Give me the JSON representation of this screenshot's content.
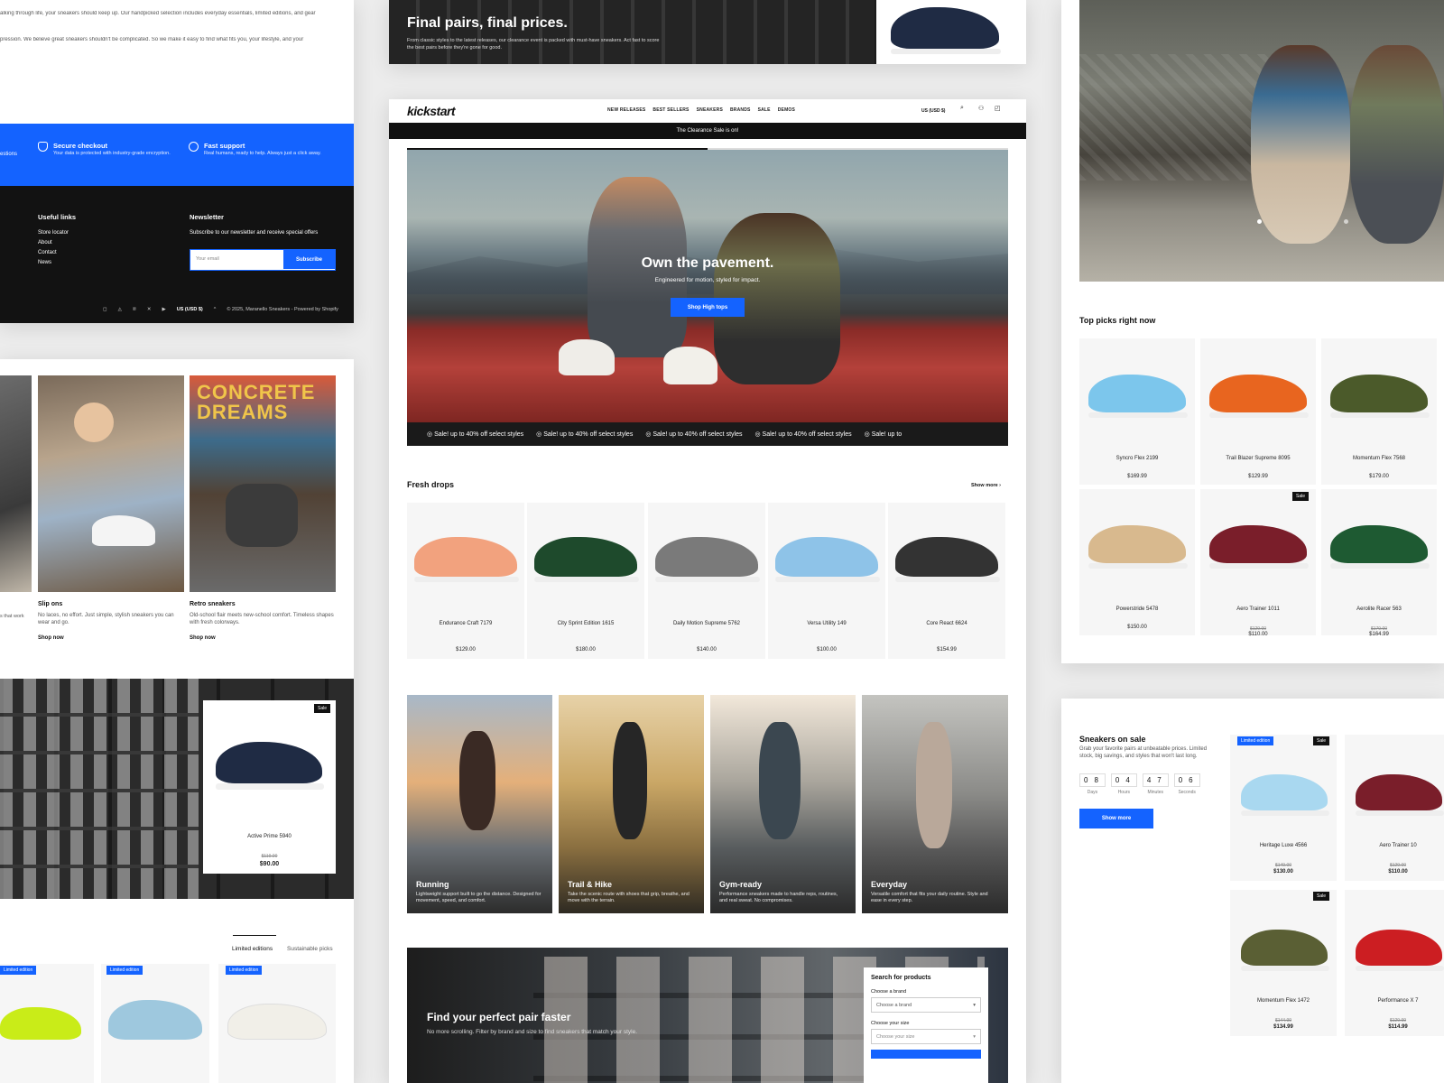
{
  "colors": {
    "accent": "#1463ff",
    "dark": "#111111",
    "footer_bg": "#121212"
  },
  "left_top": {
    "text_lines": [
      "alking through life, your sneakers should keep up. Our handpicked selection includes everyday essentials, limited editions, and gear",
      "pression. We believe great sneakers shouldn't be complicated. So we make it easy to find what fits you, your lifestyle, and your"
    ],
    "band_left": "estions",
    "secure_title": "Secure checkout",
    "secure_text": "Your data is protected with industry-grade encryption.",
    "support_title": "Fast support",
    "support_text": "Real humans, ready to help. Always just a click away.",
    "useful_links_title": "Useful links",
    "links": [
      "Store locator",
      "About",
      "Contact",
      "News"
    ],
    "newsletter_title": "Newsletter",
    "newsletter_text": "Subscribe to our newsletter and receive special offers",
    "email_placeholder": "Your email",
    "subscribe_label": "Subscribe",
    "currency": "US (USD $)",
    "copyright": "© 2025, Maranello Sneakers - Powered by Shopify",
    "social_icons": [
      "instagram-icon",
      "snapchat-icon",
      "pinterest-icon",
      "x-icon",
      "youtube-icon"
    ]
  },
  "left_mid": {
    "cards": [
      {
        "title": "",
        "text": "s that work",
        "link": ""
      },
      {
        "title": "Slip ons",
        "text": "No laces, no effort. Just simple, stylish sneakers you can wear and go.",
        "link": "Shop now"
      },
      {
        "title": "Retro sneakers",
        "text": "Old-school flair meets new-school comfort. Timeless shapes with fresh colorways.",
        "link": "Shop now"
      }
    ],
    "featured": {
      "badge": "Sale",
      "name": "Active Prime 5940",
      "old_price": "$119.00",
      "price": "$90.00"
    },
    "tabs": [
      "Limited editions",
      "Sustainable picks"
    ],
    "badges": [
      "Limited edition",
      "Limited edition",
      "Limited edition"
    ]
  },
  "center": {
    "promo_title": "Final pairs, final prices.",
    "promo_text": "From classic styles to the latest releases, our clearance event is packed with must-have sneakers. Act fast to score the best pairs before they're gone for good.",
    "logo": "kickstart",
    "nav": [
      "NEW RELEASES",
      "BEST SELLERS",
      "SNEAKERS",
      "BRANDS",
      "SALE",
      "DEMOS"
    ],
    "currency": "US (USD $)",
    "announcement": "The Clearance Sale is on!",
    "hero_title": "Own the pavement.",
    "hero_sub": "Engineered for motion, styled for impact.",
    "hero_button": "Shop High tops",
    "marquee": [
      "Sale! up to 40% off select styles",
      "Sale! up to 40% off select styles",
      "Sale! up to 40% off select styles",
      "Sale! up to 40% off select styles",
      "Sale! up to"
    ],
    "fresh_title": "Fresh drops",
    "show_more": "Show more",
    "products": [
      {
        "name": "Endurance Craft 7179",
        "price": "$129.00",
        "color": "#f2a27e"
      },
      {
        "name": "City Sprint Edition 1615",
        "price": "$180.00",
        "color": "#1e4a2c"
      },
      {
        "name": "Daily Motion Supreme 5762",
        "price": "$140.00",
        "color": "#7a7a7a"
      },
      {
        "name": "Versa Utility 149",
        "price": "$100.00",
        "color": "#8ec3e8"
      },
      {
        "name": "Core React 6624",
        "price": "$154.99",
        "color": "#333333"
      }
    ],
    "tiles": [
      {
        "title": "Running",
        "text": "Lightweight support built to go the distance. Designed for movement, speed, and comfort."
      },
      {
        "title": "Trail & Hike",
        "text": "Take the scenic route with shoes that grip, breathe, and move with the terrain."
      },
      {
        "title": "Gym-ready",
        "text": "Performance sneakers made to handle reps, routines, and real sweat. No compromises."
      },
      {
        "title": "Everyday",
        "text": "Versatile comfort that fits your daily routine. Style and ease in every step."
      }
    ],
    "finder_title": "Find your perfect pair faster",
    "finder_text": "No more scrolling. Filter by brand and size to find sneakers that match your style.",
    "search_title": "Search for products",
    "brand_label": "Choose a brand",
    "brand_value": "Choose a brand",
    "size_label": "Choose your size",
    "size_value": "Choose your size"
  },
  "right": {
    "top_picks_title": "Top picks right now",
    "picks": [
      {
        "name": "Syncro Flex 2199",
        "price": "$169.99",
        "old": "",
        "color": "#7cc6ec",
        "badge": ""
      },
      {
        "name": "Trail Blazer Supreme 8095",
        "price": "$129.99",
        "old": "",
        "color": "#e8651f",
        "badge": ""
      },
      {
        "name": "Momentum Flex 7568",
        "price": "$179.00",
        "old": "",
        "color": "#4b5a2a",
        "badge": ""
      },
      {
        "name": "Powerstride 5478",
        "price": "$150.00",
        "old": "",
        "color": "#d8b98e",
        "badge": ""
      },
      {
        "name": "Aero Trainer 1011",
        "price": "$110.00",
        "old": "$129.00",
        "color": "#7a1e2a",
        "badge": "Sale"
      },
      {
        "name": "Aerolite Racer 563",
        "price": "$164.99",
        "old": "$179.00",
        "color": "#1e5a32",
        "badge": ""
      }
    ],
    "sale_title": "Sneakers on sale",
    "sale_text": "Grab your favorite pairs at unbeatable prices. Limited stock, big savings, and styles that won't last long.",
    "countdown": [
      {
        "digits": "08",
        "label": "Days"
      },
      {
        "digits": "04",
        "label": "Hours"
      },
      {
        "digits": "47",
        "label": "Minutes"
      },
      {
        "digits": "06",
        "label": "Seconds"
      }
    ],
    "show_more": "Show more",
    "sale_items": [
      {
        "name": "Heritage Luxe 4566",
        "old": "$149.00",
        "price": "$130.00",
        "color": "#a9d8f0",
        "badge": "Sale",
        "badge2": "Limited edition"
      },
      {
        "name": "Aero Trainer 10",
        "old": "$129.00",
        "price": "$110.00",
        "color": "#7a1e2a",
        "badge": "",
        "badge2": ""
      },
      {
        "name": "Momentum Flex 1472",
        "old": "$144.99",
        "price": "$134.99",
        "color": "#5a5f34",
        "badge": "Sale",
        "badge2": ""
      },
      {
        "name": "Performance X 7",
        "old": "$129.99",
        "price": "$114.99",
        "color": "#cc1e22",
        "badge": "",
        "badge2": ""
      }
    ]
  }
}
